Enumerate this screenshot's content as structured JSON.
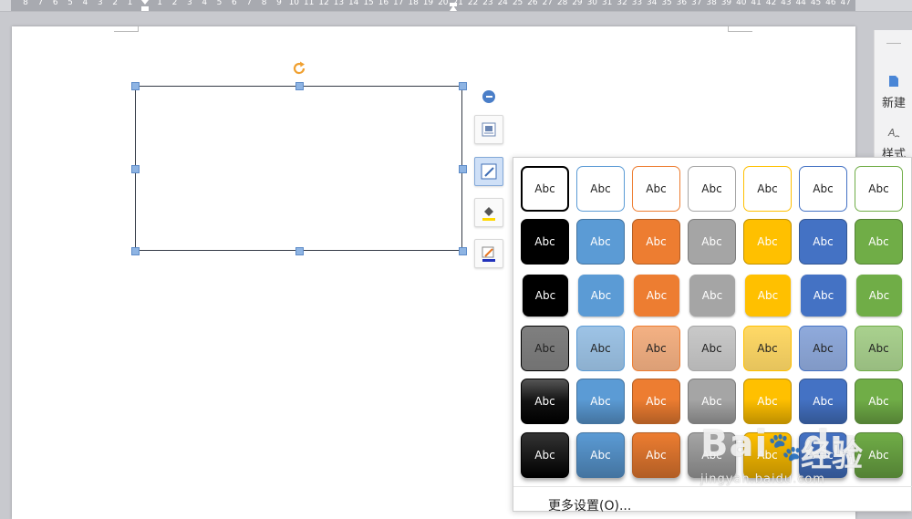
{
  "ruler": {
    "numbers": [
      "8",
      "7",
      "6",
      "5",
      "4",
      "3",
      "2",
      "1",
      "",
      "1",
      "2",
      "3",
      "4",
      "5",
      "6",
      "7",
      "8",
      "9",
      "10",
      "11",
      "12",
      "13",
      "14",
      "15",
      "16",
      "17",
      "18",
      "19",
      "20",
      "21",
      "22",
      "23",
      "24",
      "25",
      "26",
      "27",
      "28",
      "29",
      "30",
      "31",
      "32",
      "33",
      "34",
      "35",
      "36",
      "37",
      "38",
      "39",
      "40",
      "41",
      "42",
      "43",
      "44",
      "45",
      "46",
      "47"
    ]
  },
  "sidebar": {
    "items": [
      {
        "label": "新建",
        "icon": "new-document-icon"
      },
      {
        "label": "样式",
        "icon": "style-icon"
      }
    ]
  },
  "floating_toolbar": {
    "buttons": [
      {
        "name": "layout-options",
        "icon": "layout-options-icon"
      },
      {
        "name": "shape-style",
        "icon": "shape-style-icon",
        "active": true
      },
      {
        "name": "fill",
        "icon": "fill-bucket-icon"
      },
      {
        "name": "outline",
        "icon": "outline-pen-icon"
      }
    ]
  },
  "gallery": {
    "sample_text": "Abc",
    "more_settings": "更多设置(O)...",
    "colors": [
      "#000000",
      "#5b9bd5",
      "#ed7d31",
      "#a5a5a5",
      "#ffc000",
      "#4472c4",
      "#70ad47"
    ],
    "light_colors": [
      "#7f7f7f",
      "#9dc3e6",
      "#f4b183",
      "#c9c9c9",
      "#ffd966",
      "#8faadc",
      "#a9d18e"
    ],
    "rows": 6
  },
  "watermark": {
    "logo": "Bai",
    "logo2": "du",
    "brand_cn": "经验",
    "url": "jingyan.baidu.com"
  }
}
